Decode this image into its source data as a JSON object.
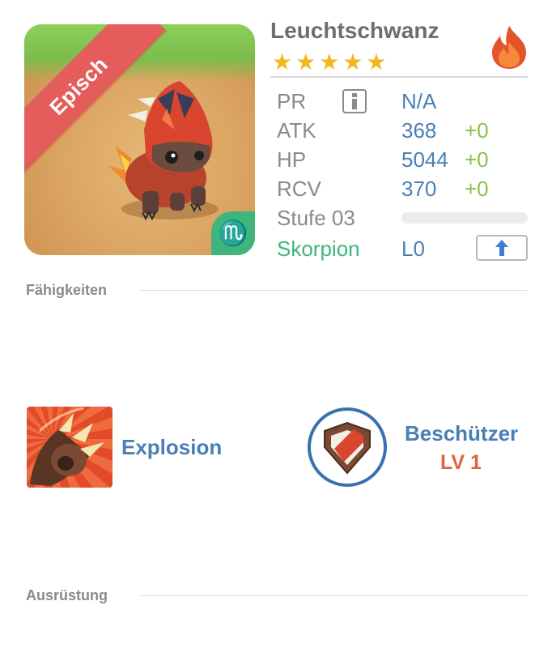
{
  "card": {
    "rarity": "Episch",
    "zodiac_symbol": "♏"
  },
  "monster": {
    "name": "Leuchtschwanz",
    "stars": "★★★★★",
    "element_icon": "fire-icon"
  },
  "stats": {
    "pr_label": "PR",
    "pr_value": "N/A",
    "atk_label": "ATK",
    "atk_value": "368",
    "atk_bonus": "+0",
    "hp_label": "HP",
    "hp_value": "5044",
    "hp_bonus": "+0",
    "rcv_label": "RCV",
    "rcv_value": "370",
    "rcv_bonus": "+0",
    "level_label": "Stufe 03",
    "level_progress": 0,
    "zodiac_name": "Skorpion",
    "limit_value": "L0"
  },
  "sections": {
    "abilities": "Fähigkeiten",
    "equipment": "Ausrüstung"
  },
  "skills": {
    "active_name": "Explosion",
    "active_icon": "claw-icon",
    "leader_name": "Beschützer",
    "leader_level": "LV 1",
    "leader_icon": "shield-icon"
  },
  "colors": {
    "value_blue": "#4a7fb5",
    "bonus_green": "#86c34a",
    "zodiac_green": "#3fb57c",
    "rarity_red": "#e45d5b",
    "level_orange": "#e3623a",
    "star_gold": "#f2b61f"
  }
}
